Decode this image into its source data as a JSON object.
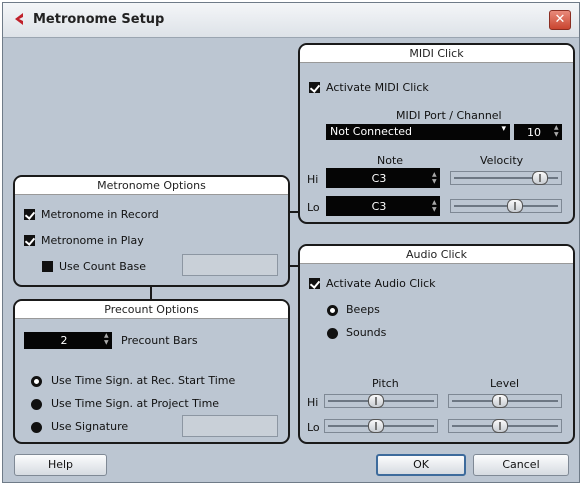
{
  "window": {
    "title": "Metronome Setup",
    "close_label": "✕"
  },
  "midi_click": {
    "title": "MIDI Click",
    "activate_label": "Activate MIDI Click",
    "port_channel_label": "MIDI Port / Channel",
    "port_value": "Not Connected",
    "channel_value": "10",
    "note_label": "Note",
    "velocity_label": "Velocity",
    "hi_label": "Hi",
    "lo_label": "Lo",
    "hi_note": "C3",
    "lo_note": "C3",
    "hi_velocity": 0.88,
    "lo_velocity": 0.6
  },
  "metronome_options": {
    "title": "Metronome Options",
    "in_record_label": "Metronome in Record",
    "in_play_label": "Metronome in Play",
    "count_base_label": "Use Count Base"
  },
  "precount_options": {
    "title": "Precount Options",
    "bars_value": "2",
    "bars_label": "Precount Bars",
    "opt_rec_start": "Use Time Sign. at Rec. Start Time",
    "opt_project": "Use Time Sign. at Project Time",
    "opt_signature": "Use Signature"
  },
  "audio_click": {
    "title": "Audio Click",
    "activate_label": "Activate Audio Click",
    "beeps_label": "Beeps",
    "sounds_label": "Sounds",
    "pitch_label": "Pitch",
    "level_label": "Level",
    "hi_label": "Hi",
    "lo_label": "Lo",
    "hi_pitch": 0.45,
    "lo_pitch": 0.45,
    "hi_level": 0.45,
    "lo_level": 0.45
  },
  "buttons": {
    "help": "Help",
    "ok": "OK",
    "cancel": "Cancel"
  },
  "icons": {
    "title": "cubase-logo-icon",
    "close": "close-icon"
  }
}
